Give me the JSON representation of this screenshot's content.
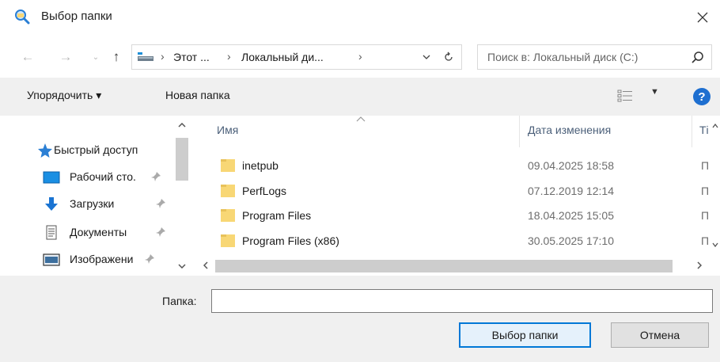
{
  "window": {
    "title": "Выбор папки",
    "icon": "folder-search-icon"
  },
  "address": {
    "crumbs": [
      "Этот ...",
      "Локальный ди..."
    ],
    "separator": "›",
    "pc_icon": "computer-icon"
  },
  "search": {
    "placeholder": "Поиск в: Локальный диск (C:)"
  },
  "toolbar": {
    "organize_label": "Упорядочить ▾",
    "new_folder_label": "Новая папка",
    "help_label": "?"
  },
  "nav": {
    "items": [
      {
        "label": "Быстрый доступ",
        "icon": "star-icon",
        "pinned": false
      },
      {
        "label": "Рабочий сто.",
        "icon": "desktop-icon",
        "pinned": true
      },
      {
        "label": "Загрузки",
        "icon": "download-icon",
        "pinned": true
      },
      {
        "label": "Документы",
        "icon": "document-icon",
        "pinned": true
      },
      {
        "label": "Изображени",
        "icon": "image-icon",
        "pinned": true
      }
    ]
  },
  "filelist": {
    "columns": {
      "name": "Имя",
      "date": "Дата изменения",
      "type": "Ті"
    },
    "rows": [
      {
        "name": "inetpub",
        "date": "09.04.2025 18:58",
        "type": "П"
      },
      {
        "name": "PerfLogs",
        "date": "07.12.2019 12:14",
        "type": "П"
      },
      {
        "name": "Program Files",
        "date": "18.04.2025 15:05",
        "type": "П"
      },
      {
        "name": "Program Files (x86)",
        "date": "30.05.2025 17:10",
        "type": "П"
      }
    ]
  },
  "bottom": {
    "folder_label": "Папка:",
    "folder_value": "",
    "select_button": "Выбор папки",
    "cancel_button": "Отмена"
  },
  "colors": {
    "accent": "#0078d7",
    "folder": "#f8d775",
    "toolbar_bg": "#f0f0f0"
  }
}
